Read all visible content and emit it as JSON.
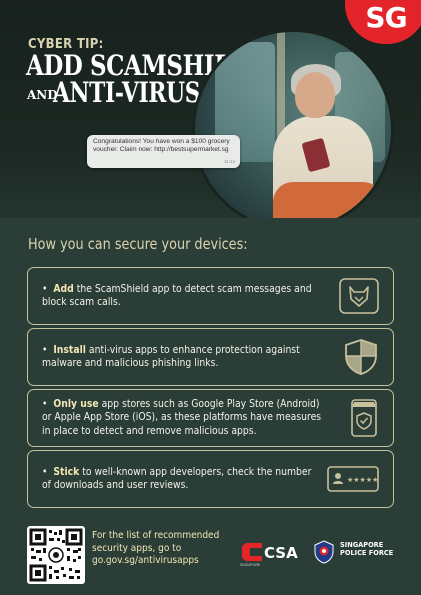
{
  "badge": {
    "text": "SG"
  },
  "hero": {
    "kicker": "CYBER TIP:",
    "headline_line1": "ADD SCAMSHIELD",
    "headline_and": "AND",
    "headline_line2": "ANTI-VIRUS APPS",
    "sms_message": "Congratulations! You have won a $100 grocery voucher. Claim now: http://bestsupermarket.sg",
    "sms_time": "11:14"
  },
  "section": {
    "title": "How you can secure your devices:"
  },
  "tips": [
    {
      "keyword": "Add",
      "text": " the ScamShield app to detect scam messages and block scam calls.",
      "icon": "scamshield-fox-icon"
    },
    {
      "keyword": "Install",
      "text": " anti-virus apps to enhance protection against malware and malicious phishing links.",
      "icon": "shield-icon"
    },
    {
      "keyword": "Only use",
      "text": " app stores such as Google Play Store (Android) or Apple App Store (iOS), as these platforms have measures in place to detect and remove malicious apps.",
      "icon": "secure-store-icon"
    },
    {
      "keyword": "Stick",
      "text": " to well-known app developers, check the number of downloads and user reviews.",
      "icon": "user-rating-icon"
    }
  ],
  "footer": {
    "text": "For the list of recommended security apps, go to go.gov.sg/antivirusapps",
    "text_line1": "For the list of recommended",
    "text_line2": "security apps, go to",
    "link": "go.gov.sg/antivirusapps",
    "csa_name": "CSA",
    "csa_sub": "SINGAPORE",
    "spf_line1": "SINGAPORE",
    "spf_line2": "POLICE FORCE"
  },
  "colors": {
    "background": "#2a3d36",
    "accent_text": "#d9d3b0",
    "border": "#c7c09c",
    "badge_red": "#e4242b"
  }
}
